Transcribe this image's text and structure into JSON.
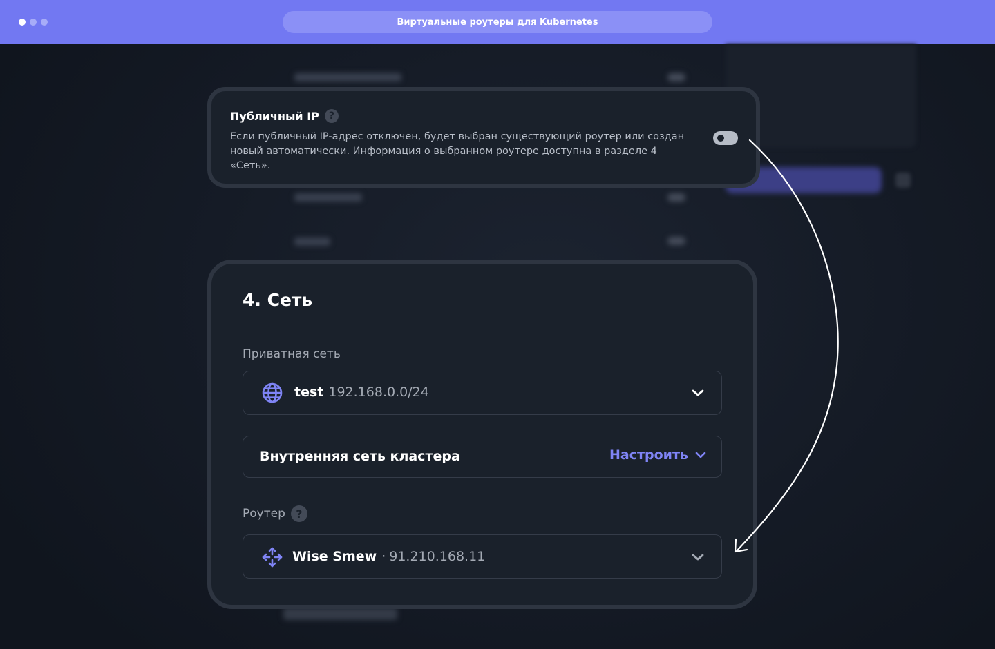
{
  "window": {
    "title": "Виртуальные роутеры для Kubernetes"
  },
  "public_ip": {
    "title": "Публичный IP",
    "help": "?",
    "description": "Если публичный IP-адрес отключен, будет выбран существующий роутер или создан новый автоматически. Информация о выбранном роутере доступна в разделе 4 «Сеть».",
    "toggle_on": false
  },
  "network": {
    "title": "4. Сеть",
    "private_network": {
      "label": "Приватная сеть",
      "selected_name": "test",
      "selected_cidr": "192.168.0.0/24"
    },
    "cluster_network": {
      "label": "Внутренняя сеть кластера",
      "action": "Настроить"
    },
    "router": {
      "label": "Роутер",
      "help": "?",
      "selected_name": "Wise Smew",
      "separator": "·",
      "selected_ip": "91.210.168.11"
    }
  },
  "colors": {
    "accent": "#7f84f5",
    "topbar": "#7278f2",
    "card": "#1a212b"
  },
  "icons": {
    "network": "globe-icon",
    "router": "router-arrows-icon",
    "dropdown": "chevron-down-icon"
  }
}
